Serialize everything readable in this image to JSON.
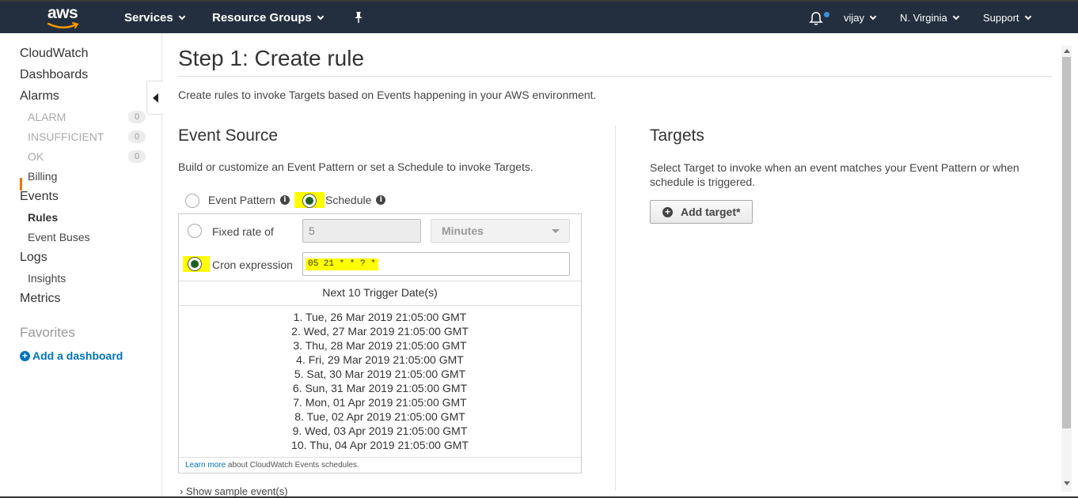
{
  "header": {
    "logo_text": "aws",
    "services": "Services",
    "resource_groups": "Resource Groups",
    "user": "vijay",
    "region": "N. Virginia",
    "support": "Support"
  },
  "sidebar": {
    "cloudwatch": "CloudWatch",
    "dashboards": "Dashboards",
    "alarms": "Alarms",
    "alarm": "ALARM",
    "alarm_count": "0",
    "insufficient": "INSUFFICIENT",
    "insufficient_count": "0",
    "ok": "OK",
    "ok_count": "0",
    "billing": "Billing",
    "events": "Events",
    "rules": "Rules",
    "event_buses": "Event Buses",
    "logs": "Logs",
    "insights": "Insights",
    "metrics": "Metrics",
    "favorites": "Favorites",
    "add_dashboard": "Add a dashboard"
  },
  "page": {
    "title": "Step 1: Create rule",
    "intro": "Create rules to invoke Targets based on Events happening in your AWS environment."
  },
  "event_source": {
    "title": "Event Source",
    "description": "Build or customize an Event Pattern or set a Schedule to invoke Targets.",
    "event_pattern_label": "Event Pattern",
    "schedule_label": "Schedule",
    "fixed_rate_label": "Fixed rate of",
    "fixed_rate_value": "5",
    "fixed_rate_unit": "Minutes",
    "cron_label": "Cron expression",
    "cron_value": "05 21 * * ? *",
    "next_title": "Next 10 Trigger Date(s)",
    "dates": [
      "1. Tue, 26 Mar 2019 21:05:00 GMT",
      "2. Wed, 27 Mar 2019 21:05:00 GMT",
      "3. Thu, 28 Mar 2019 21:05:00 GMT",
      "4. Fri, 29 Mar 2019 21:05:00 GMT",
      "5. Sat, 30 Mar 2019 21:05:00 GMT",
      "6. Sun, 31 Mar 2019 21:05:00 GMT",
      "7. Mon, 01 Apr 2019 21:05:00 GMT",
      "8. Tue, 02 Apr 2019 21:05:00 GMT",
      "9. Wed, 03 Apr 2019 21:05:00 GMT",
      "10. Thu, 04 Apr 2019 21:05:00 GMT"
    ],
    "learn_more_link": "Learn more",
    "learn_more_rest": " about CloudWatch Events schedules.",
    "show_sample": "Show sample event(s)"
  },
  "targets": {
    "title": "Targets",
    "description": "Select Target to invoke when an event matches your Event Pattern or when schedule is triggered.",
    "add_target": "Add target*"
  },
  "colors": {
    "navbar": "#232f3e",
    "highlight": "#ffff00",
    "link": "#0073bb",
    "active_marker": "#ec7211"
  }
}
